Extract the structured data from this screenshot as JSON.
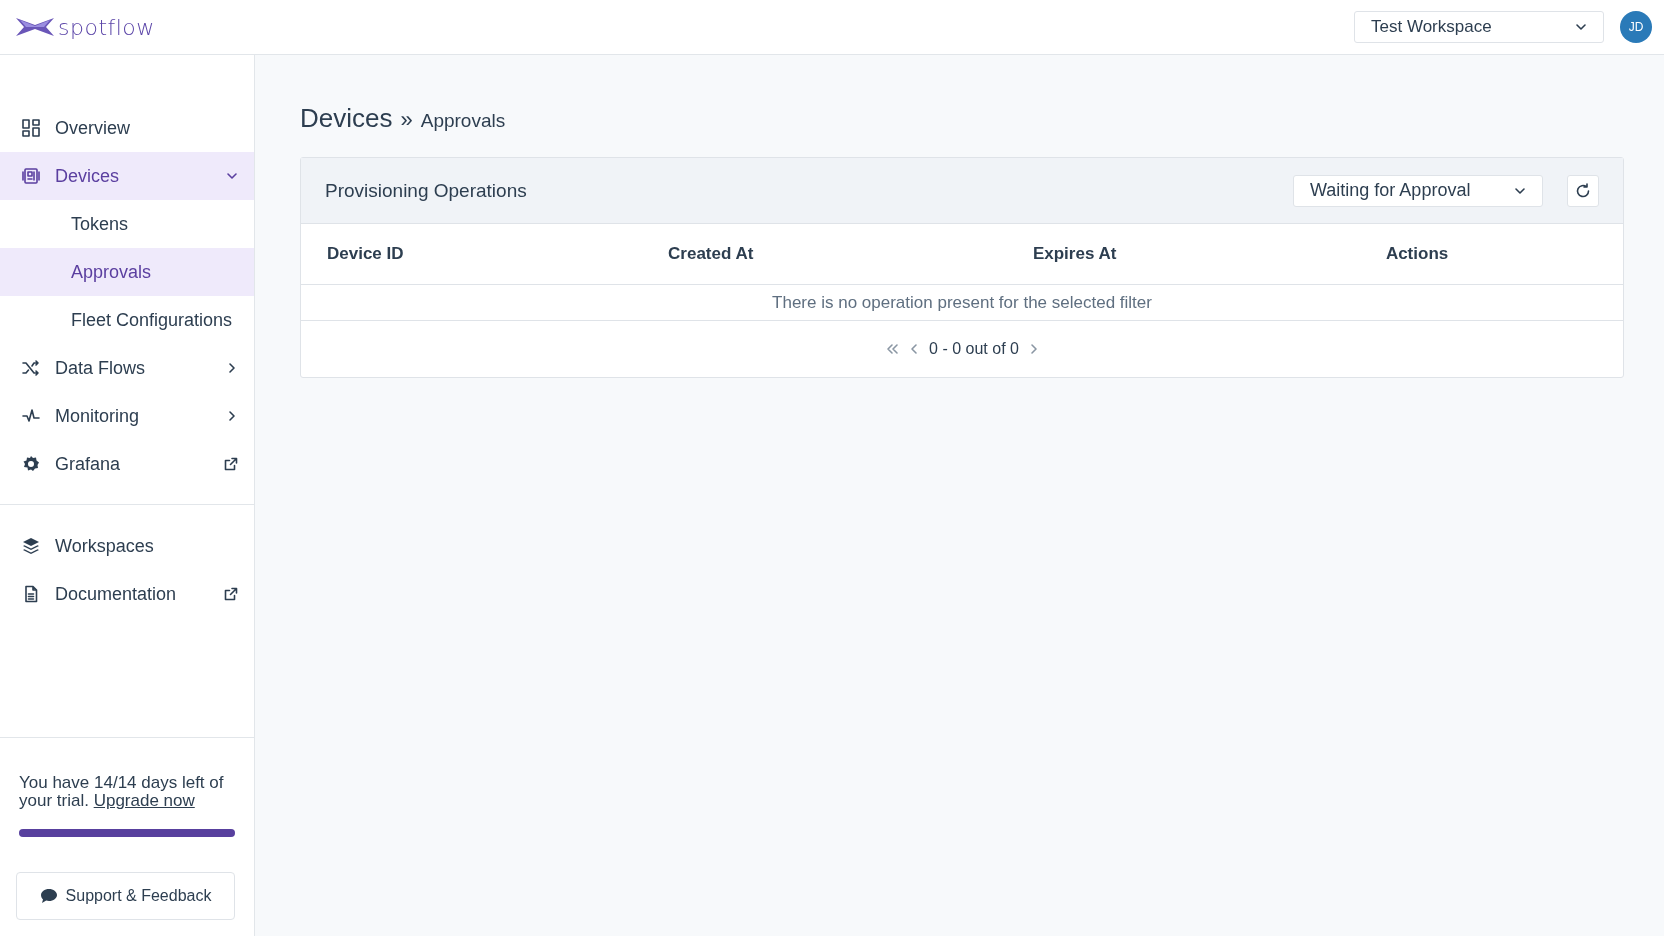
{
  "header": {
    "logo": "spotflow",
    "workspace": "Test Workspace",
    "avatar": "JD"
  },
  "sidebar": {
    "items": [
      {
        "kind": "link",
        "label": "Overview",
        "selected": false
      },
      {
        "kind": "group",
        "label": "Devices",
        "selected": true,
        "expanded": true,
        "children": [
          {
            "label": "Tokens",
            "selected": false
          },
          {
            "label": "Approvals",
            "selected": true
          },
          {
            "label": "Fleet Configurations",
            "selected": false
          }
        ]
      },
      {
        "kind": "group",
        "label": "Data Flows",
        "selected": false,
        "expanded": false
      },
      {
        "kind": "group",
        "label": "Monitoring",
        "selected": false,
        "expanded": false
      },
      {
        "kind": "external",
        "label": "Grafana",
        "selected": false
      }
    ],
    "bottom_items": [
      {
        "kind": "link",
        "label": "Workspaces",
        "selected": false
      },
      {
        "kind": "external",
        "label": "Documentation",
        "selected": false
      }
    ],
    "trial": {
      "text": "You have 14/14 days left of your trial.",
      "link": "Upgrade now",
      "level": 1
    },
    "support_button": "Support & Feedback"
  },
  "breadcrumb": {
    "title": "Devices",
    "separator": "»",
    "current": "Approvals"
  },
  "card": {
    "title": "Provisioning Operations",
    "filter": "Waiting for Approval",
    "columns": [
      "Device ID",
      "Created At",
      "Expires At",
      "Actions"
    ],
    "empty_message": "There is no operation present for the selected filter",
    "pagination": "0 - 0 out of 0"
  }
}
